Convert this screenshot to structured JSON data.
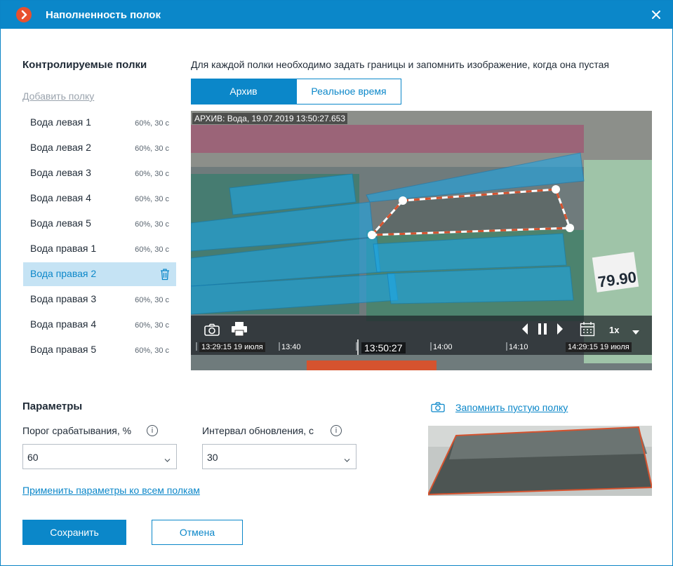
{
  "window": {
    "title": "Наполненность полок",
    "accent": "#0b87c9",
    "logo_color": "#e8502e"
  },
  "shelves": {
    "title": "Контролируемые полки",
    "add_label": "Добавить полку",
    "items": [
      {
        "name": "Вода левая 1",
        "value": "60%, 30 с"
      },
      {
        "name": "Вода левая 2",
        "value": "60%, 30 с"
      },
      {
        "name": "Вода левая 3",
        "value": "60%, 30 с"
      },
      {
        "name": "Вода левая 4",
        "value": "60%, 30 с"
      },
      {
        "name": "Вода левая 5",
        "value": "60%, 30 с"
      },
      {
        "name": "Вода правая 1",
        "value": "60%, 30 с"
      },
      {
        "name": "Вода правая 2",
        "value": ""
      },
      {
        "name": "Вода правая 3",
        "value": "60%, 30 с"
      },
      {
        "name": "Вода правая 4",
        "value": "60%, 30 с"
      },
      {
        "name": "Вода правая 5",
        "value": "60%, 30 с"
      }
    ],
    "selected_index": 6
  },
  "viewer": {
    "hint": "Для каждой полки необходимо задать границы и запомнить изображение, когда она пустая",
    "mode_archive": "Архив",
    "mode_realtime": "Реальное время",
    "caption": "АРХИВ: Вода, 19.07.2019 13:50:27.653",
    "timeline": {
      "start": "13:29:15 19 июля",
      "t1": "13:40",
      "current": "13:50:27",
      "t2": "14:00",
      "t3": "14:10",
      "end": "14:29:15 19 июля"
    },
    "speed": "1x",
    "price_tag": "79.90"
  },
  "params": {
    "title": "Параметры",
    "threshold_label": "Порог срабатывания, %",
    "threshold_value": "60",
    "interval_label": "Интервал обновления, с",
    "interval_value": "30",
    "info_glyph": "i",
    "apply_label": "Применить параметры ко всем полкам",
    "remember_label": "Запомнить пустую полку"
  },
  "footer": {
    "save_label": "Сохранить",
    "cancel_label": "Отмена"
  }
}
